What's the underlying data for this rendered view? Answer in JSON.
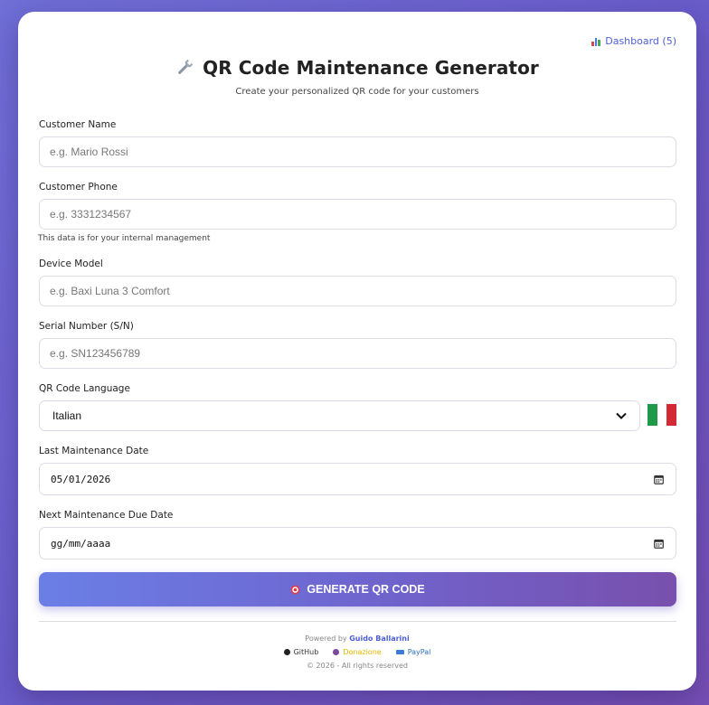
{
  "header": {
    "dashboard_link": "Dashboard (5)",
    "title": "QR Code Maintenance Generator",
    "subtitle": "Create your personalized QR code for your customers"
  },
  "form": {
    "customer_name": {
      "label": "Customer Name",
      "placeholder": "e.g. Mario Rossi",
      "value": ""
    },
    "customer_phone": {
      "label": "Customer Phone",
      "placeholder": "e.g. 3331234567",
      "value": "",
      "hint": "This data is for your internal management"
    },
    "device_model": {
      "label": "Device Model",
      "placeholder": "e.g. Baxi Luna 3 Comfort",
      "value": ""
    },
    "serial_number": {
      "label": "Serial Number (S/N)",
      "placeholder": "e.g. SN123456789",
      "value": ""
    },
    "language": {
      "label": "QR Code Language",
      "selected": "Italian"
    },
    "last_maintenance": {
      "label": "Last Maintenance Date",
      "value": "05/01/2026"
    },
    "next_maintenance": {
      "label": "Next Maintenance Due Date",
      "value": "gg/mm/aaaa"
    }
  },
  "generate_button": {
    "label": "GENERATE QR CODE"
  },
  "footer": {
    "powered_prefix": "Powered by",
    "author": "Guido Ballarini",
    "links": {
      "github": "GitHub",
      "donation": "Donazione",
      "paypal": "PayPal"
    },
    "copyright": "© 2026 - All rights reserved"
  },
  "colors": {
    "accent": "#4c5fd6",
    "button_start": "#6a7fe6",
    "button_end": "#7850ad",
    "donation": "#e5b600",
    "paypal": "#2a6fc1",
    "github": "#444444"
  }
}
